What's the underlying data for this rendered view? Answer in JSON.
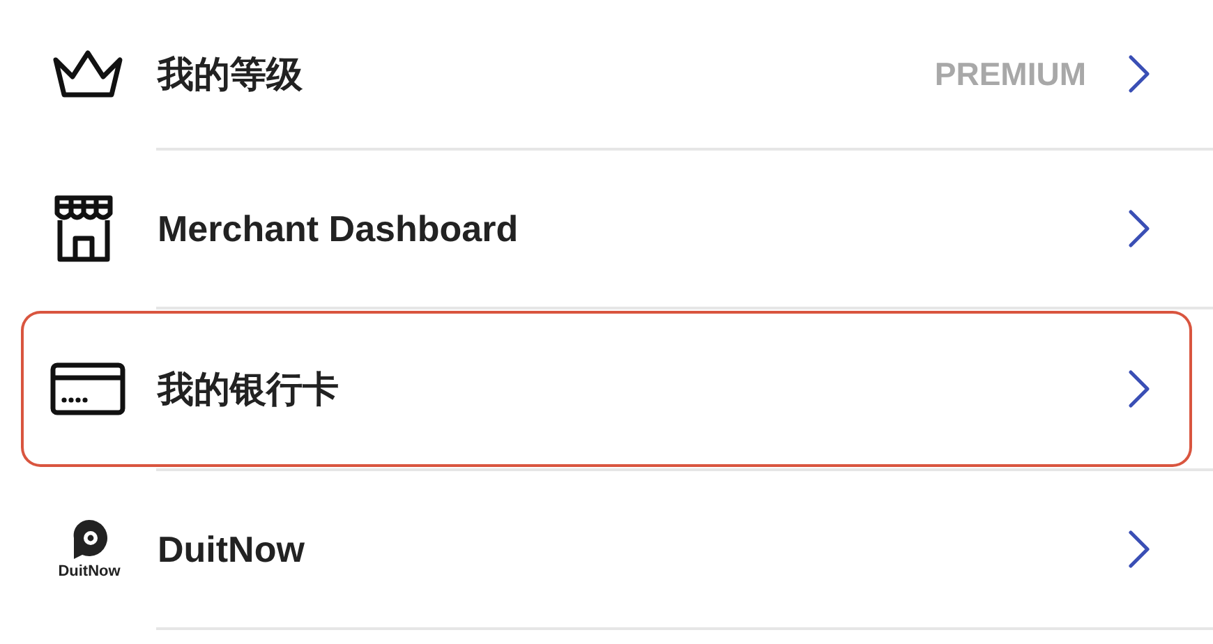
{
  "menu_items": [
    {
      "kind": "crown",
      "label": "我的等级",
      "value": "PREMIUM",
      "selected": false
    },
    {
      "kind": "store",
      "label": "Merchant Dashboard",
      "selected": false
    },
    {
      "kind": "card",
      "label": "我的银行卡",
      "selected": true
    },
    {
      "kind": "duitnow",
      "label": "DuitNow",
      "logo_text": "DuitNow",
      "selected": false
    }
  ]
}
